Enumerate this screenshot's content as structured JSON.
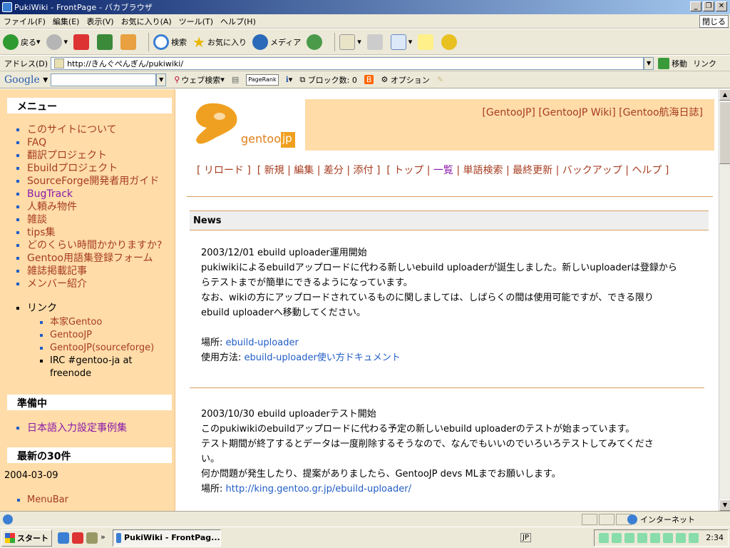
{
  "window": {
    "title": "PukiWiki - FrontPage - バカブラウザ",
    "close_label": "閉じる"
  },
  "menubar": [
    "ファイル(F)",
    "編集(E)",
    "表示(V)",
    "お気に入り(A)",
    "ツール(T)",
    "ヘルプ(H)"
  ],
  "toolbar": {
    "back": "戻る",
    "search": "検索",
    "favorites": "お気に入り",
    "media": "メディア"
  },
  "address": {
    "label": "アドレス(D)",
    "url": "http://きんぐぺんぎん/pukiwiki/",
    "go": "移動",
    "links": "リンク"
  },
  "google": {
    "logo": "Google",
    "web_search": "ウェブ検索",
    "pagerank": "PageRank",
    "block": "ブロック数: 0",
    "options": "オプション"
  },
  "sidebar": {
    "menu_title": "メニュー",
    "menu_items": [
      {
        "label": "このサイトについて",
        "visited": true
      },
      {
        "label": "FAQ",
        "visited": true
      },
      {
        "label": "翻訳プロジェクト",
        "visited": true
      },
      {
        "label": "Ebuildプロジェクト",
        "visited": true
      },
      {
        "label": "SourceForge開発者用ガイド",
        "visited": true
      },
      {
        "label": "BugTrack",
        "visited": false
      },
      {
        "label": "人頼み物件",
        "visited": true
      },
      {
        "label": "雑談",
        "visited": true
      },
      {
        "label": "tips集",
        "visited": true
      },
      {
        "label": "どのくらい時間かかりますか?",
        "visited": true
      },
      {
        "label": "Gentoo用語集登録フォーム",
        "visited": true
      },
      {
        "label": "雑誌掲載記事",
        "visited": true
      },
      {
        "label": "メンバー紹介",
        "visited": true
      }
    ],
    "links_label": "リンク",
    "links": [
      "本家Gentoo",
      "GentooJP",
      "GentooJP(sourceforge)",
      "IRC #gentoo-ja at freenode"
    ],
    "prep_title": "準備中",
    "prep_items": [
      "日本語入力設定事例集"
    ],
    "recent_title": "最新の30件",
    "recent_date": "2004-03-09",
    "recent_items": [
      "MenuBar"
    ]
  },
  "header": {
    "logo_text": "gentoo",
    "logo_jp": "jp",
    "top_links": [
      "[GentooJP]",
      "[GentooJP Wiki]",
      "[Gentoo航海日誌]"
    ]
  },
  "toolnav": [
    "リロード",
    "新規",
    "編集",
    "差分",
    "添付",
    "トップ",
    "一覧",
    "単語検索",
    "最終更新",
    "バックアップ",
    "ヘルプ"
  ],
  "news_title": "News",
  "entries": [
    {
      "heading": "2003/12/01 ebuild uploader運用開始",
      "lines": [
        "pukiwikiによるebuildアップロードに代わる新しいebuild uploaderが誕生しました。新しいuploaderは登録から",
        "らテストまでが簡単にできるようになっています。",
        "なお、wikiの方にアップロードされているものに関しましては、しばらくの間は使用可能ですが、できる限り",
        "ebuild uploaderへ移動してください。"
      ],
      "place_label": "場所:",
      "place_link": "ebuild-uploader",
      "usage_label": "使用方法:",
      "usage_link": "ebuild-uploader使い方ドキュメント"
    },
    {
      "heading": "2003/10/30 ebuild uploaderテスト開始",
      "lines": [
        "このpukiwikiのebuildアップロードに代わる予定の新しいebuild uploaderのテストが始まっています。",
        "テスト期間が終了するとデータは一度削除するそうなので、なんでもいいのでいろいろテストしてみてくださ",
        "い。",
        "何か問題が発生したり、提案がありましたら、GentooJP devs MLまでお願いします。"
      ],
      "place_label": "場所:",
      "place_link": "http://king.gentoo.gr.jp/ebuild-uploader/"
    }
  ],
  "statusbar": {
    "zone": "インターネット"
  },
  "taskbar": {
    "start": "スタート",
    "task": "PukiWiki - FrontPag...",
    "ime": "JP",
    "clock": "2:34"
  }
}
